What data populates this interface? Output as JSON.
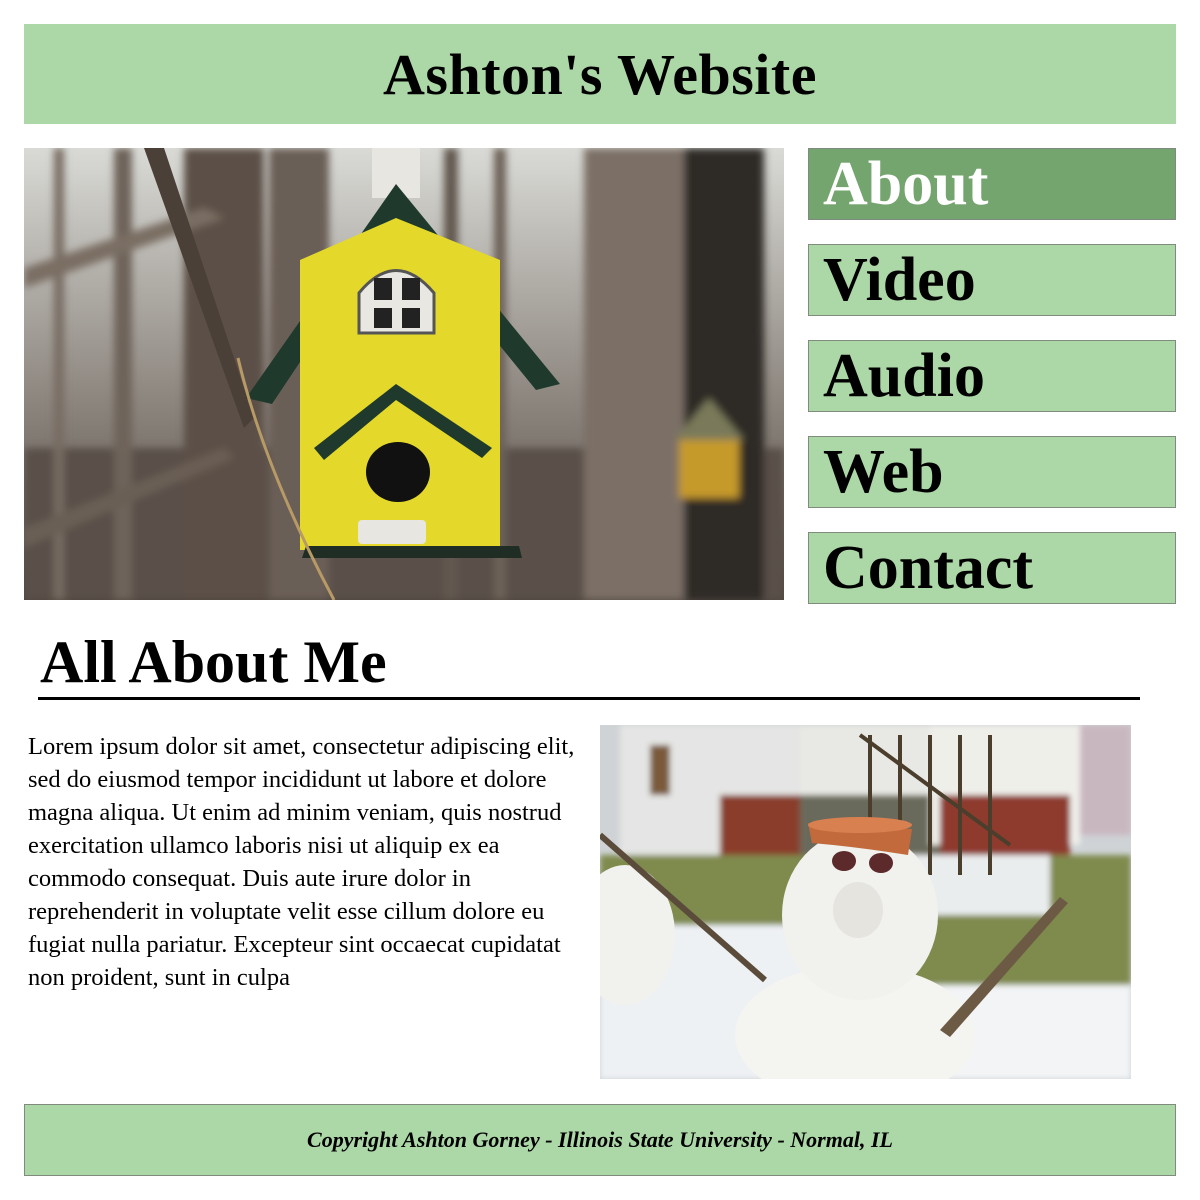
{
  "site": {
    "title": "Ashton's Website"
  },
  "nav": {
    "items": [
      {
        "label": "About",
        "active": true
      },
      {
        "label": "Video",
        "active": false
      },
      {
        "label": "Audio",
        "active": false
      },
      {
        "label": "Web",
        "active": false
      },
      {
        "label": "Contact",
        "active": false
      }
    ]
  },
  "section": {
    "title": "All About Me",
    "body": "Lorem ipsum dolor sit amet, consectetur adipiscing elit, sed do eiusmod tempor incididunt ut labore et dolore magna aliqua. Ut enim ad minim veniam, quis nostrud exercitation ullamco laboris nisi ut aliquip ex ea commodo consequat. Duis aute irure dolor in reprehenderit in voluptate velit esse cillum dolore eu fugiat nulla pariatur. Excepteur sint occaecat cupidatat non proident, sunt in culpa"
  },
  "footer": {
    "text": "Copyright Ashton Gorney - Illinois State University - Normal, IL"
  },
  "colors": {
    "accent": "#acd7a6",
    "active": "#74a56e",
    "border": "#7f8c7d"
  }
}
